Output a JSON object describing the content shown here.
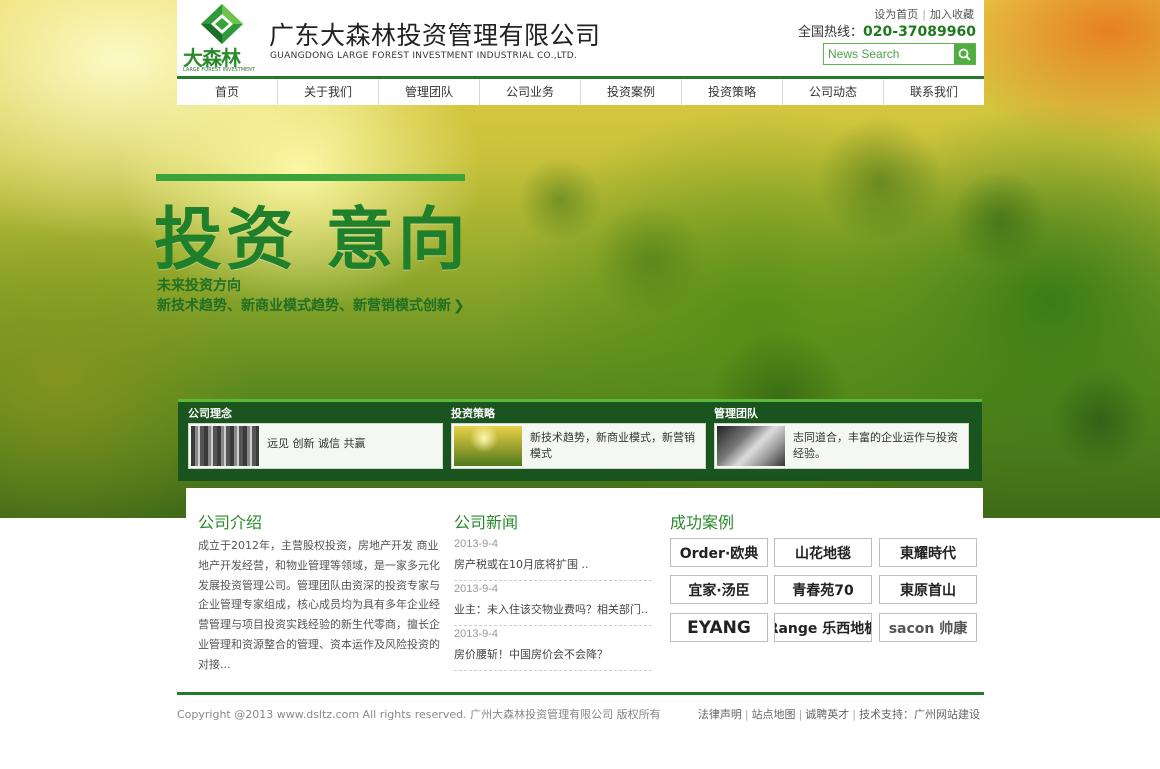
{
  "header": {
    "logo_text": "大森林",
    "logo_sub": "LARGE FOREST INVESTMENT",
    "company_cn": "广东大森林投资管理有限公司",
    "company_en": "GUANGDONG LARGE FOREST INVESTMENT INDUSTRIAL CO.,LTD.",
    "set_home": "设为首页",
    "add_fav": "加入收藏",
    "hotline_label": "全国热线：",
    "hotline_number": "020-37089960",
    "search_placeholder": "News Search"
  },
  "nav": [
    {
      "label": "首页"
    },
    {
      "label": "关于我们"
    },
    {
      "label": "管理团队"
    },
    {
      "label": "公司业务"
    },
    {
      "label": "投资案例"
    },
    {
      "label": "投资策略"
    },
    {
      "label": "公司动态"
    },
    {
      "label": "联系我们"
    }
  ],
  "hero": {
    "title": "投资 意向",
    "sub1": "未来投资方向",
    "sub2": "新技术趋势、新商业模式趋势、新营销模式创新",
    "arrow": "❯"
  },
  "features": [
    {
      "title": "公司理念",
      "text": "远见 创新 诚信 共赢"
    },
    {
      "title": "投资策略",
      "text": "新技术趋势，新商业模式，新营销模式"
    },
    {
      "title": "管理团队",
      "text": "志同道合，丰富的企业运作与投资经验。"
    }
  ],
  "about": {
    "title": "公司介绍",
    "text": "成立于2012年，主营股权投资，房地产开发  商业地产开发经营，和物业管理等领域，是一家多元化发展投资管理公司。管理团队由资深的投资专家与企业管理专家组成，核心成员均为具有多年企业经营管理与项目投资实践经验的新生代零商，擅长企业管理和资源整合的管理、资本运作及风险投资的对接..."
  },
  "news": {
    "title": "公司新闻",
    "items": [
      {
        "date": "2013-9-4",
        "title": "房产税或在10月底将扩围 .."
      },
      {
        "date": "2013-9-4",
        "title": "业主：未入住该交物业费吗？相关部门.."
      },
      {
        "date": "2013-9-4",
        "title": "房价腰斩！中国房价会不会降？"
      }
    ]
  },
  "cases": {
    "title": "成功案例",
    "items": [
      {
        "label": "Order·欧典"
      },
      {
        "label": "山花地毯"
      },
      {
        "label": "東耀時代"
      },
      {
        "label": "宜家·汤臣"
      },
      {
        "label": "青春苑70"
      },
      {
        "label": "東原首山"
      },
      {
        "label": "EYANG"
      },
      {
        "label": "Range 乐西地板"
      },
      {
        "label": "sacon 帅康"
      }
    ]
  },
  "footer": {
    "copyright": "Copyright @2013 www.dsltz.com All rights reserved. 广州大森林投资管理有限公司 版权所有",
    "links": [
      {
        "label": "法律声明"
      },
      {
        "label": "站点地图"
      },
      {
        "label": "诚聘英才"
      },
      {
        "label": "技术支持：广州网站建设"
      }
    ]
  },
  "colors": {
    "brand_green": "#257a2a",
    "accent_green": "#4fae3f",
    "hotline_green": "#1f7a1f"
  }
}
